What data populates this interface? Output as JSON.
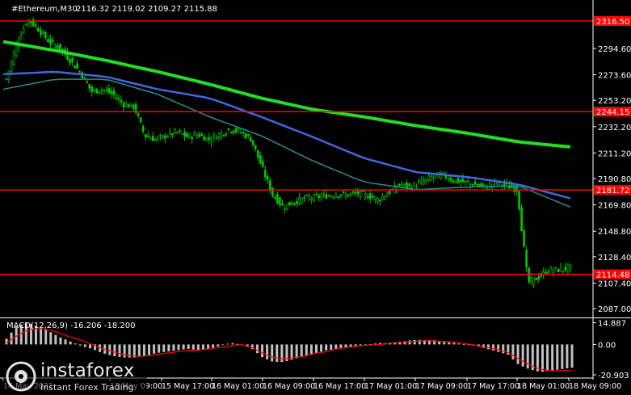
{
  "header": {
    "symbol": "#Ethereum,M30",
    "ohlc": "2116.32 2119.02 2109.27 2115.88"
  },
  "colors": {
    "background": "#000000",
    "candle": "#00c800",
    "ma_fast": "#2e8b8b",
    "ma_mid": "#4466dd",
    "ma_slow": "#22dd22",
    "level": "#ff0000",
    "macd_hist": "#c0c0c0",
    "macd_signal": "#ff0000",
    "axis": "#ffffff"
  },
  "chart_data": [
    {
      "type": "candlestick",
      "ylim": [
        2080,
        2330
      ],
      "y_ticks": [
        "2294.60",
        "2273.60",
        "2253.20",
        "2232.20",
        "2211.20",
        "2190.80",
        "2169.80",
        "2148.80",
        "2128.40",
        "2107.40",
        "2087.00"
      ],
      "y_tick_values": [
        2294.6,
        2273.6,
        2253.2,
        2232.2,
        2211.2,
        2190.8,
        2169.8,
        2148.8,
        2128.4,
        2107.4,
        2087.0
      ],
      "horizontal_levels": [
        {
          "label": "2316.50",
          "value": 2316.5
        },
        {
          "label": "2244.15",
          "value": 2244.15
        },
        {
          "label": "2181.72",
          "value": 2181.72
        },
        {
          "label": "2114.48",
          "value": 2114.48
        }
      ],
      "x_ticks": [
        "14 May 2021",
        "15 May 09:00",
        "15 May 17:00",
        "16 May 01:00",
        "16 May 09:00",
        "16 May 17:00",
        "17 May 01:00",
        "17 May 09:00",
        "17 May 17:00",
        "18 May 01:00",
        "18 May 09:00"
      ],
      "price_path": [
        2270,
        2300,
        2318,
        2310,
        2300,
        2295,
        2285,
        2275,
        2260,
        2262,
        2258,
        2250,
        2248,
        2225,
        2222,
        2225,
        2228,
        2224,
        2226,
        2222,
        2226,
        2230,
        2228,
        2222,
        2200,
        2178,
        2168,
        2172,
        2175,
        2176,
        2177,
        2178,
        2178,
        2179,
        2177,
        2174,
        2180,
        2186,
        2184,
        2188,
        2192,
        2194,
        2189,
        2188,
        2186,
        2184,
        2188,
        2185,
        2182,
        2108,
        2112,
        2118,
        2118,
        2120
      ],
      "ma_slow": [
        2300,
        2293,
        2285,
        2276,
        2266,
        2255,
        2246,
        2240,
        2233,
        2227,
        2220,
        2216
      ],
      "ma_mid": [
        2274,
        2276,
        2272,
        2262,
        2255,
        2240,
        2224,
        2207,
        2196,
        2192,
        2186,
        2175
      ],
      "ma_fast": [
        2262,
        2270,
        2270,
        2258,
        2240,
        2225,
        2205,
        2188,
        2182,
        2184,
        2185,
        2168
      ]
    },
    {
      "type": "bar",
      "label": "MACD(12,26,9) -16.206 -18.200",
      "ylim": [
        -22,
        18
      ],
      "y_ticks": [
        "14.887",
        "0.00",
        "-20.903"
      ],
      "y_tick_values": [
        14.887,
        0,
        -20.903
      ],
      "macd_path": [
        4,
        13,
        15,
        12,
        9,
        5,
        2,
        -1,
        -3,
        -6,
        -8,
        -9,
        -9,
        -8,
        -6,
        -5,
        -4,
        -3,
        -4,
        -3,
        -1,
        1,
        0,
        -3,
        -9,
        -12,
        -12,
        -10,
        -8,
        -6,
        -4,
        -3,
        -2,
        -1,
        0,
        1,
        1,
        2,
        3,
        3,
        3,
        2,
        1,
        0,
        -1,
        -3,
        -5,
        -7,
        -14,
        -17,
        -19,
        -18,
        -17,
        -16
      ],
      "signal_path": [
        1,
        6,
        10,
        11,
        10,
        8,
        5,
        3,
        0,
        -3,
        -5,
        -7,
        -8,
        -8,
        -7,
        -6,
        -5,
        -4,
        -4,
        -3,
        -2,
        -1,
        0,
        -2,
        -6,
        -9,
        -10,
        -9,
        -8,
        -6,
        -5,
        -3,
        -2,
        -1,
        -0.5,
        0,
        1,
        1.5,
        2,
        2.5,
        2.5,
        2,
        1.5,
        0.5,
        -0.5,
        -2,
        -3.5,
        -5.5,
        -10,
        -14,
        -17,
        -18,
        -18,
        -18
      ]
    }
  ],
  "logo": {
    "name": "instaforex",
    "tagline": "Instant Forex Trading"
  }
}
